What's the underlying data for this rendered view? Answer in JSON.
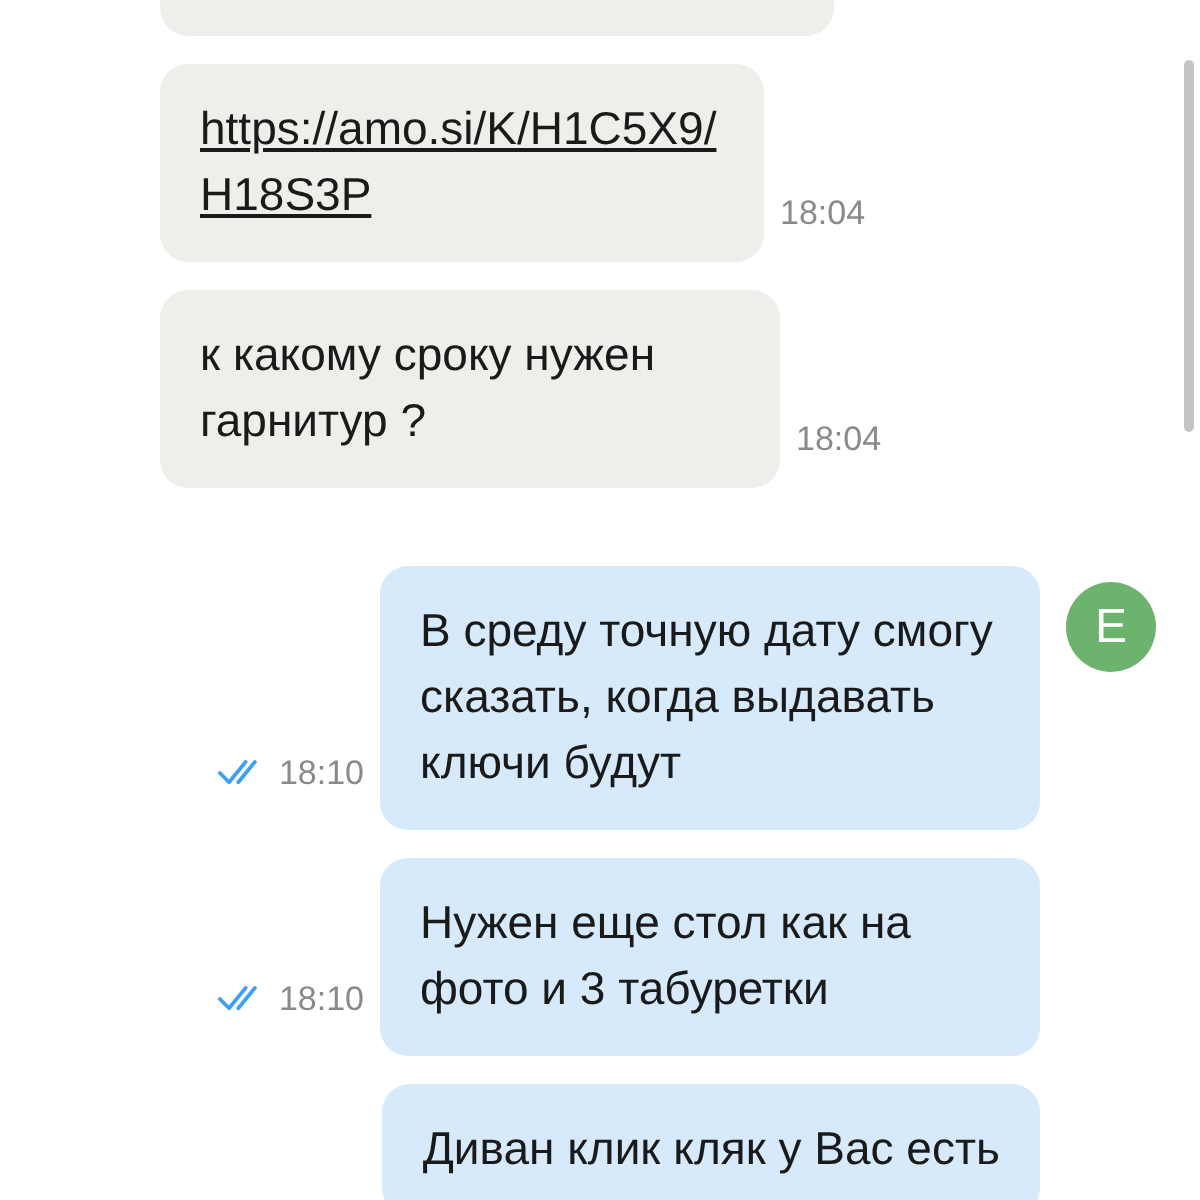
{
  "messages": [
    {
      "kind": "cut"
    },
    {
      "kind": "incoming",
      "text": "https://amo.si/K/H1C5X9/H18S3P",
      "link": true,
      "time": "18:04"
    },
    {
      "kind": "incoming",
      "text": "к какому сроку нужен гарнитур ?",
      "link": false,
      "time": "18:04"
    },
    {
      "kind": "outgoing",
      "text": "В среду точную дату смогу сказать, когда выдавать ключи будут",
      "time": "18:10",
      "read": true,
      "avatar": "E"
    },
    {
      "kind": "outgoing",
      "text": "Нужен еще стол как на фото и 3 табуретки",
      "time": "18:10",
      "read": true
    },
    {
      "kind": "outgoing",
      "text": "Диван клик кляк у Вас есть"
    }
  ]
}
